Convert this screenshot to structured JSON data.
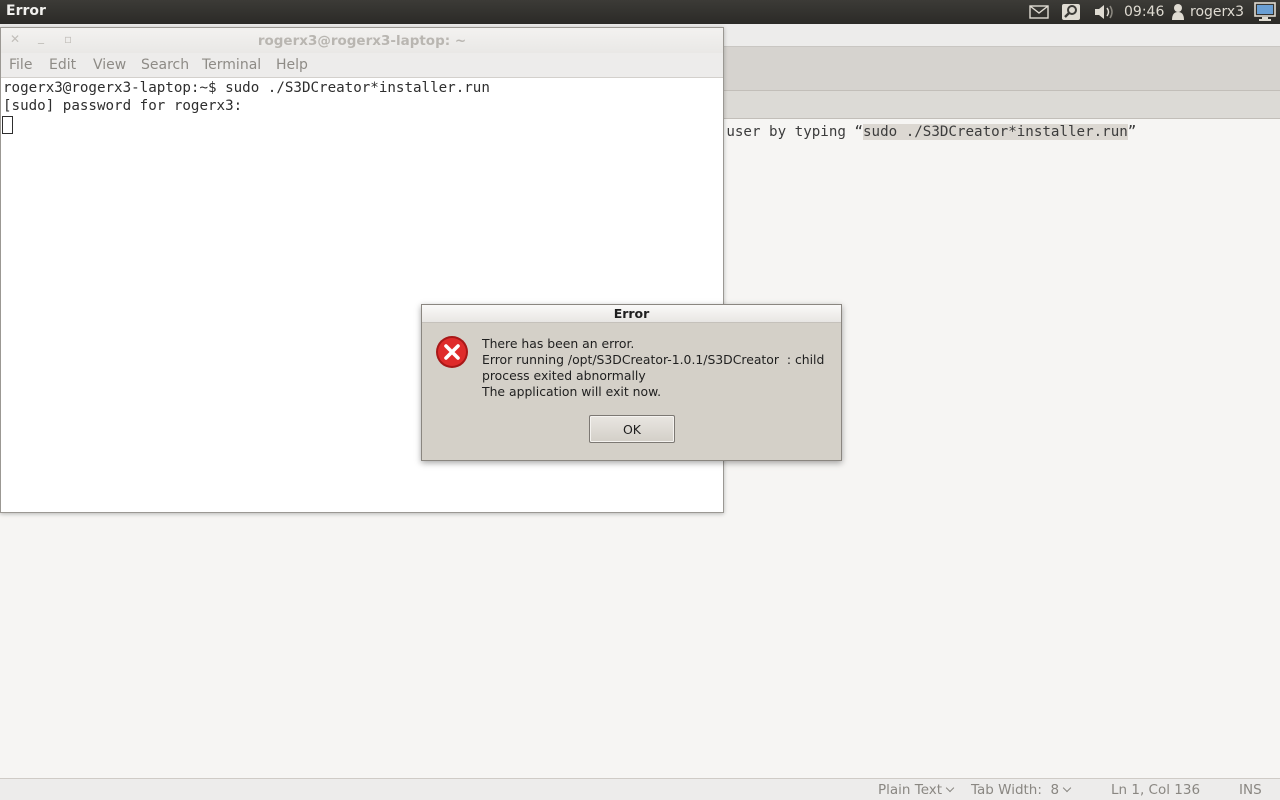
{
  "panel": {
    "title": "Error",
    "clock": "09:46",
    "user": "rogerx3",
    "icons": [
      "mail-icon",
      "network-icon",
      "volume-icon",
      "user-icon",
      "system-icon"
    ]
  },
  "editor": {
    "line_prefix": "s super-user by typing “",
    "line_selected": "sudo ./S3DCreator*installer.run",
    "line_suffix": "”",
    "status": {
      "language": "Plain Text",
      "tab_width": "Tab Width:  8",
      "position": "Ln 1, Col 136",
      "mode": "INS"
    }
  },
  "terminal": {
    "title": "rogerx3@rogerx3-laptop: ~",
    "menu": [
      "File",
      "Edit",
      "View",
      "Search",
      "Terminal",
      "Help"
    ],
    "lines": [
      "rogerx3@rogerx3-laptop:~$ sudo ./S3DCreator*installer.run",
      "[sudo] password for rogerx3:"
    ]
  },
  "dialog": {
    "title": "Error",
    "message": [
      "There has been an error.",
      "Error running /opt/S3DCreator-1.0.1/S3DCreator  : child",
      "process exited abnormally",
      "The application will exit now."
    ],
    "ok_label": "OK",
    "icon": "error-icon"
  },
  "colors": {
    "panel_bg": "#3c3b37",
    "dialog_bg": "#d4d0c8",
    "error_red": "#df2b2b"
  }
}
